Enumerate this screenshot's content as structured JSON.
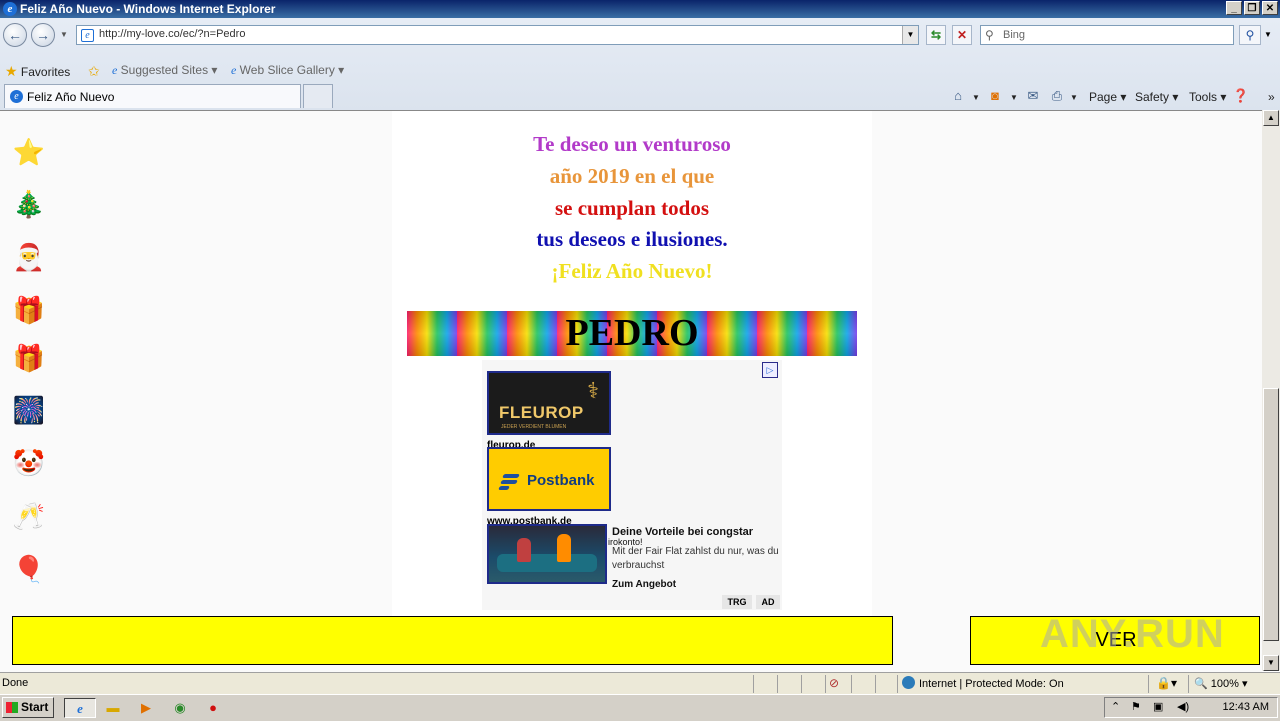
{
  "window": {
    "title": "Feliz Año Nuevo - Windows Internet Explorer"
  },
  "toolbar": {
    "address": "http://my-love.co/ec/?n=Pedro",
    "search_placeholder": "Bing"
  },
  "favorites": {
    "label": "Favorites",
    "items": [
      "Suggested Sites ▾",
      "Web Slice Gallery ▾"
    ]
  },
  "tabs": [
    {
      "label": "Feliz Año Nuevo"
    }
  ],
  "commandbar": {
    "page": "Page ▾",
    "safety": "Safety ▾",
    "tools": "Tools ▾"
  },
  "content": {
    "message_lines": [
      {
        "text": "Te deseo un venturoso",
        "color": "#b23ac9"
      },
      {
        "text": "año 2019 en el que",
        "color": "#e8953a"
      },
      {
        "text": "se cumplan todos",
        "color": "#d41010"
      },
      {
        "text": "tus deseos e ilusiones.",
        "color": "#1010b0"
      },
      {
        "text": "¡Feliz Año Nuevo!",
        "color": "#f0e020"
      }
    ],
    "name": "PEDRO",
    "side_emojis": [
      "⭐",
      "🎄",
      "🎅",
      "🎁",
      "🎁",
      "🎆",
      "🤡",
      "🥂",
      "🎈"
    ]
  },
  "ads": {
    "fleurop": {
      "brand": "FLEUROP",
      "tagline": "JEDER VERDIENT BLUMEN",
      "link": "fleurop.de"
    },
    "postbank": {
      "brand": "Postbank",
      "link": "www.postbank.de"
    },
    "congstar": {
      "headline": "Deine Vorteile bei congstar",
      "overlap": "irokonto!",
      "body": "Mit der Fair Flat zahlst du nur, was du verbrauchst",
      "cta": "Zum Angebot"
    },
    "trg": "TRG",
    "ad": "AD"
  },
  "bottom": {
    "ver": "VER",
    "watermark": "ANY.RUN"
  },
  "status": {
    "text": "Done",
    "zone": "Internet | Protected Mode: On",
    "zoom": "100%"
  },
  "taskbar": {
    "start": "Start",
    "clock": "12:43 AM"
  }
}
